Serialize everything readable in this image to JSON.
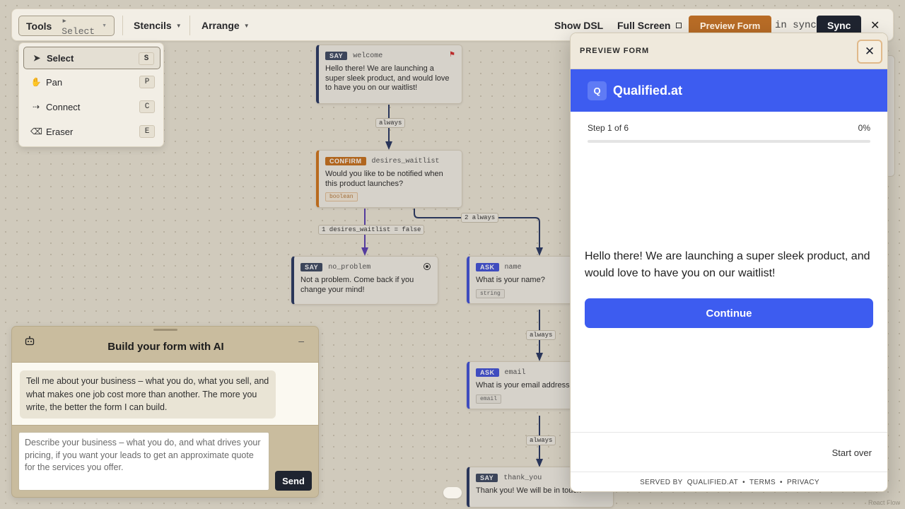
{
  "toolbar": {
    "tools_label": "Tools",
    "tools_current": "Select",
    "stencils_label": "Stencils",
    "arrange_label": "Arrange",
    "show_dsl_label": "Show DSL",
    "full_screen_label": "Full Screen",
    "preview_form_label": "Preview Form",
    "sync_status": "in sync",
    "sync_label": "Sync",
    "close_icon": "✕"
  },
  "tools_menu": {
    "items": [
      {
        "label": "Select",
        "key": "S",
        "icon": "cursor-icon",
        "glyph": "➤"
      },
      {
        "label": "Pan",
        "key": "P",
        "icon": "hand-icon",
        "glyph": "✋"
      },
      {
        "label": "Connect",
        "key": "C",
        "icon": "connect-icon",
        "glyph": "⇢"
      },
      {
        "label": "Eraser",
        "key": "E",
        "icon": "eraser-icon",
        "glyph": "⌫"
      }
    ]
  },
  "nodes": {
    "welcome": {
      "badge": "SAY",
      "id": "welcome",
      "text": "Hello there! We are launching a super sleek product, and would love to have you on our waitlist!"
    },
    "desires_waitlist": {
      "badge": "CONFIRM",
      "id": "desires_waitlist",
      "text": "Would you like to be notified when this product launches?",
      "type": "boolean"
    },
    "no_problem": {
      "badge": "SAY",
      "id": "no_problem",
      "text": "Not a problem. Come back if you change your mind!"
    },
    "name": {
      "badge": "ASK",
      "id": "name",
      "text": "What is your name?",
      "type": "string"
    },
    "email": {
      "badge": "ASK",
      "id": "email",
      "text": "What is your email address?",
      "type": "email"
    },
    "thank_you": {
      "badge": "SAY",
      "id": "thank_you",
      "text": "Thank you! We will be in touch"
    }
  },
  "edges": {
    "e1": "always",
    "e2": "1 desires_waitlist = false",
    "e3": "2 always",
    "e4": "always",
    "e5": "always"
  },
  "ai_panel": {
    "title": "Build your form with AI",
    "minimize": "–",
    "assistant_message": "Tell me about your business – what you do, what you sell, and what makes one job cost more than another. The more you write, the better the form I can build.",
    "input_placeholder": "Describe your business – what you do, and what drives your pricing, if you want your leads to get an approximate quote for the services you offer.",
    "send_label": "Send"
  },
  "preview": {
    "title": "PREVIEW FORM",
    "close": "✕",
    "brand_initial": "Q",
    "brand_name": "Qualified.at",
    "step_label": "Step 1 of 6",
    "percent_label": "0%",
    "progress": 0,
    "message": "Hello there! We are launching a super sleek product, and would love to have you on our waitlist!",
    "continue_label": "Continue",
    "start_over_label": "Start over",
    "served_by": "SERVED BY",
    "served_site": "QUALIFIED.AT",
    "bullet": "•",
    "terms": "TERMS",
    "privacy": "PRIVACY"
  },
  "watermark": "React Flow",
  "colors": {
    "canvas": "#ece6d6",
    "brand_blue": "#3d5cf0",
    "preview_orange": "#b86c26",
    "dark": "#1f2430",
    "confirm_orange": "#c8711f",
    "ask_blue": "#4353d9"
  }
}
